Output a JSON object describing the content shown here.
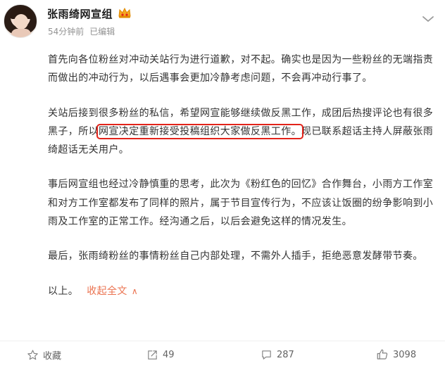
{
  "post": {
    "author": "张雨绮网宣组",
    "time": "54分钟前",
    "edited": "已编辑",
    "paragraphs": [
      [
        "首先向各位粉丝对冲动关站行为进行道歉，对不起。确实也是因为一些粉丝的无端指责而做出的冲动行为，以后遇事会更加冷静考虑问题，不会再冲动行事了。"
      ],
      [
        "关站后接到很多粉丝的私信，希望网宣能够继续做反黑工作，成团后热搜评论也有很多黑子，所以",
        "网宣决定重新接受投稿组织大家做反黑工作。",
        "现已联系超话主持人屏蔽张雨绮超话无关用户。"
      ],
      [
        "事后网宣组也经过冷静慎重的思考，此次为《粉红色的回忆》合作舞台，小雨方工作室和对方工作室都发布了同样的照片，属于节目宣传行为，不应该让饭圈的纷争影响到小雨及工作室的正常工作。经沟通之后，以后会避免这样的情况发生。"
      ],
      [
        "最后，张雨绮粉丝的事情粉丝自己内部处理，不需外人插手，拒绝恶意发酵带节奏。"
      ]
    ],
    "ending": "以上。",
    "collapse_label": "收起全文",
    "collapse_arrow": "∧"
  },
  "actions": {
    "favorite_label": "收藏",
    "repost_count": "49",
    "comment_count": "287",
    "like_count": "3098"
  },
  "colors": {
    "highlight_box": "#e2231a",
    "link": "#eb7350",
    "meta_text": "#939393"
  },
  "icons": [
    "avatar",
    "crown-icon",
    "more-icon",
    "star-icon",
    "repost-icon",
    "comment-icon",
    "like-icon"
  ]
}
